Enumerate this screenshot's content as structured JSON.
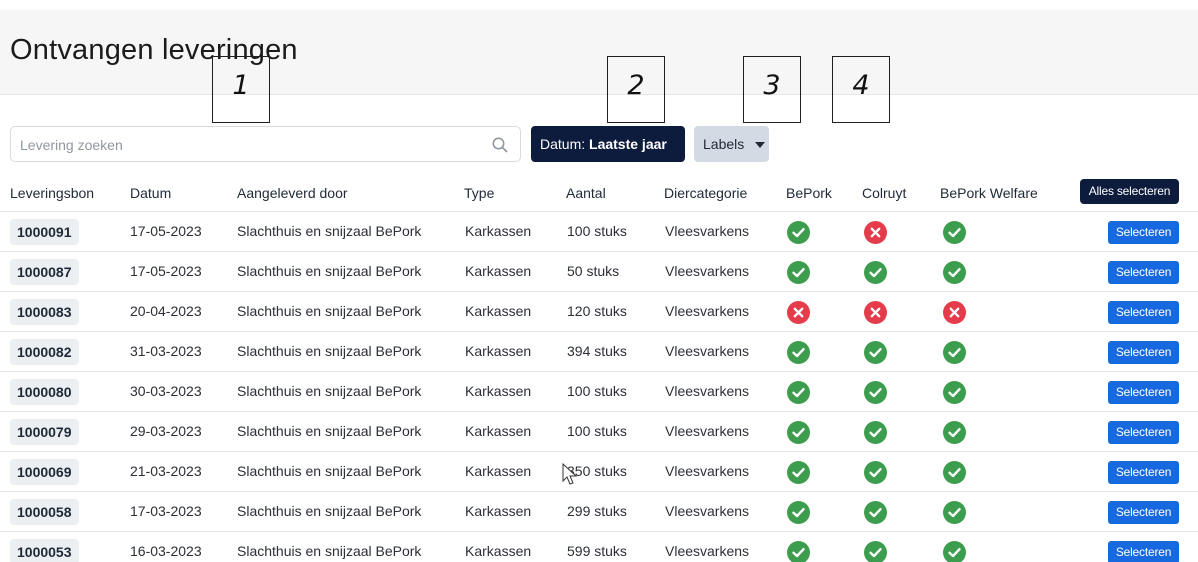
{
  "page": {
    "title": "Ontvangen leveringen"
  },
  "callouts": [
    "1",
    "2",
    "3",
    "4"
  ],
  "search": {
    "placeholder": "Levering zoeken",
    "value": "",
    "icon": "search-icon"
  },
  "filters": {
    "date_prefix": "Datum:",
    "date_value": "Laatste jaar",
    "labels": "Labels"
  },
  "table": {
    "columns": [
      "Leveringsbon",
      "Datum",
      "Aangeleverd door",
      "Type",
      "Aantal",
      "Diercategorie",
      "BePork",
      "Colruyt",
      "BePork Welfare"
    ],
    "select_all_label": "Alles selecteren",
    "select_label": "Selecteren",
    "rows": [
      {
        "bon": "1000091",
        "datum": "17-05-2023",
        "door": "Slachthuis en snijzaal BePork",
        "type": "Karkassen",
        "aantal": "100 stuks",
        "categorie": "Vleesvarkens",
        "bepork": "ok",
        "colruyt": "ko",
        "welfare": "ok"
      },
      {
        "bon": "1000087",
        "datum": "17-05-2023",
        "door": "Slachthuis en snijzaal BePork",
        "type": "Karkassen",
        "aantal": "50 stuks",
        "categorie": "Vleesvarkens",
        "bepork": "ok",
        "colruyt": "ok",
        "welfare": "ok"
      },
      {
        "bon": "1000083",
        "datum": "20-04-2023",
        "door": "Slachthuis en snijzaal BePork",
        "type": "Karkassen",
        "aantal": "120 stuks",
        "categorie": "Vleesvarkens",
        "bepork": "ko",
        "colruyt": "ko",
        "welfare": "ko"
      },
      {
        "bon": "1000082",
        "datum": "31-03-2023",
        "door": "Slachthuis en snijzaal BePork",
        "type": "Karkassen",
        "aantal": "394 stuks",
        "categorie": "Vleesvarkens",
        "bepork": "ok",
        "colruyt": "ok",
        "welfare": "ok"
      },
      {
        "bon": "1000080",
        "datum": "30-03-2023",
        "door": "Slachthuis en snijzaal BePork",
        "type": "Karkassen",
        "aantal": "100 stuks",
        "categorie": "Vleesvarkens",
        "bepork": "ok",
        "colruyt": "ok",
        "welfare": "ok"
      },
      {
        "bon": "1000079",
        "datum": "29-03-2023",
        "door": "Slachthuis en snijzaal BePork",
        "type": "Karkassen",
        "aantal": "100 stuks",
        "categorie": "Vleesvarkens",
        "bepork": "ok",
        "colruyt": "ok",
        "welfare": "ok"
      },
      {
        "bon": "1000069",
        "datum": "21-03-2023",
        "door": "Slachthuis en snijzaal BePork",
        "type": "Karkassen",
        "aantal": "350 stuks",
        "categorie": "Vleesvarkens",
        "bepork": "ok",
        "colruyt": "ok",
        "welfare": "ok"
      },
      {
        "bon": "1000058",
        "datum": "17-03-2023",
        "door": "Slachthuis en snijzaal BePork",
        "type": "Karkassen",
        "aantal": "299 stuks",
        "categorie": "Vleesvarkens",
        "bepork": "ok",
        "colruyt": "ok",
        "welfare": "ok"
      },
      {
        "bon": "1000053",
        "datum": "16-03-2023",
        "door": "Slachthuis en snijzaal BePork",
        "type": "Karkassen",
        "aantal": "599 stuks",
        "categorie": "Vleesvarkens",
        "bepork": "ok",
        "colruyt": "ok",
        "welfare": "ok"
      }
    ]
  },
  "colors": {
    "primary_dark": "#0d1b3d",
    "select_blue": "#1769e0",
    "ok_green": "#3d9d4f",
    "error_red": "#e43c4a",
    "tag_gray": "#eceff2"
  }
}
